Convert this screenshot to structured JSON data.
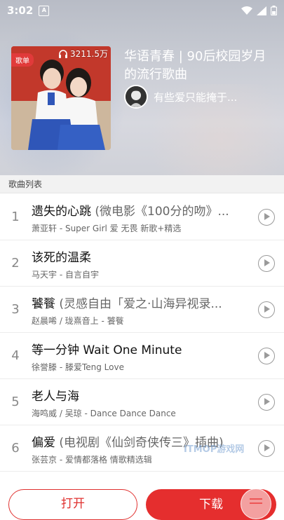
{
  "status_bar": {
    "time": "3:02",
    "notification_icon": "A"
  },
  "playlist": {
    "badge": "歌单",
    "play_count": "3211.5万",
    "title": "华语青春 | 90后校园岁月的流行歌曲",
    "creator_name": "有些爱只能掩于..."
  },
  "section": {
    "title": "歌曲列表"
  },
  "songs": [
    {
      "index": "1",
      "title": "遗失的心跳",
      "subtitle": " (微电影《100分的吻》...",
      "meta": "萧亚轩 - Super Girl 爱 无畏 新歌+精选"
    },
    {
      "index": "2",
      "title": "该死的温柔",
      "subtitle": "",
      "meta": "马天宇 - 自言自宇"
    },
    {
      "index": "3",
      "title": "饕餮",
      "subtitle": " (灵感自由「爱之·山海异视录...",
      "meta": "赵晨唏 / 珑熹音上 - 饕餮"
    },
    {
      "index": "4",
      "title": "等一分钟 Wait One Minute",
      "subtitle": "",
      "meta": "徐誉滕 - 滕爱Teng Love"
    },
    {
      "index": "5",
      "title": "老人与海",
      "subtitle": "",
      "meta": "海鸣威 / 吴琼 - Dance Dance Dance"
    },
    {
      "index": "6",
      "title": "偏爱",
      "subtitle": " (电视剧《仙剑奇侠传三》插曲)",
      "meta": "张芸京 - 爱情都落格 情歌精选辑"
    }
  ],
  "buttons": {
    "open_label": "打开",
    "download_label": "下载"
  },
  "watermark": "ITMOP游戏网",
  "colors": {
    "accent": "#e52e2e",
    "badge": "#e13a3a"
  }
}
